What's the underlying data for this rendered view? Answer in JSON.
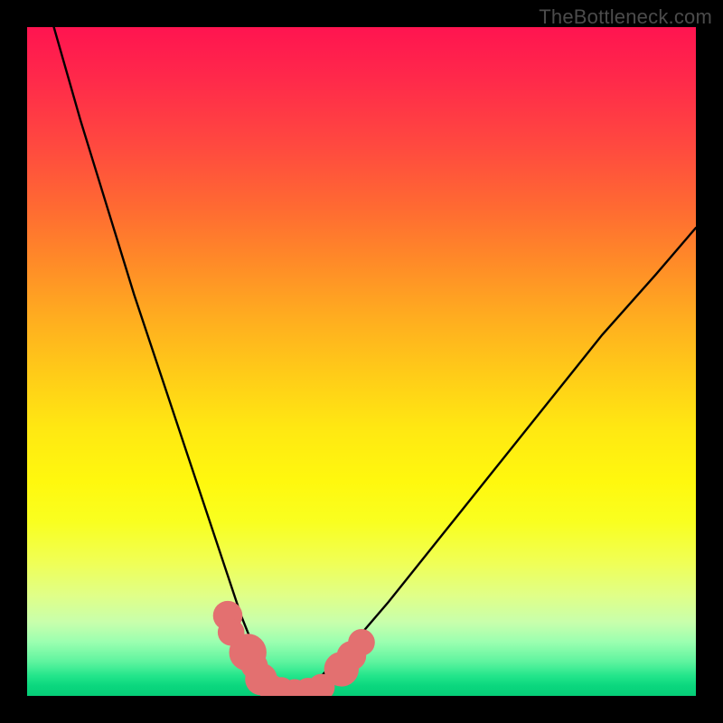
{
  "watermark": "TheBottleneck.com",
  "gradient_colors": {
    "top": "#ff1450",
    "mid_orange": "#ff8a28",
    "mid_yellow": "#fff80e",
    "bottom": "#05cd77"
  },
  "chart_data": {
    "type": "line",
    "title": "",
    "xlabel": "",
    "ylabel": "",
    "x_range": [
      0,
      100
    ],
    "y_range": [
      0,
      100
    ],
    "series": [
      {
        "name": "bottleneck-curve",
        "x": [
          4,
          8,
          12,
          16,
          20,
          24,
          28,
          30,
          32,
          34,
          36,
          38,
          40,
          42,
          44,
          48,
          54,
          62,
          70,
          78,
          86,
          94,
          100
        ],
        "values": [
          100,
          86,
          73,
          60,
          48,
          36,
          24,
          18,
          12,
          7,
          3,
          1,
          0.3,
          1,
          3,
          7,
          14,
          24,
          34,
          44,
          54,
          63,
          70
        ]
      }
    ],
    "markers": [
      {
        "name": "points-left",
        "x": 30,
        "y": 12,
        "r": 2.2
      },
      {
        "name": "points-left",
        "x": 30.5,
        "y": 9.5,
        "r": 2.0
      },
      {
        "name": "points-left",
        "x": 33,
        "y": 6.5,
        "r": 2.8
      },
      {
        "name": "points-left",
        "x": 34,
        "y": 4.5,
        "r": 2.0
      },
      {
        "name": "points-left",
        "x": 35,
        "y": 2.5,
        "r": 2.4
      },
      {
        "name": "points-left",
        "x": 36.5,
        "y": 1.2,
        "r": 2.0
      },
      {
        "name": "points-bottom",
        "x": 38,
        "y": 0.8,
        "r": 2.0
      },
      {
        "name": "points-bottom",
        "x": 40,
        "y": 0.5,
        "r": 2.0
      },
      {
        "name": "points-bottom",
        "x": 42,
        "y": 0.7,
        "r": 2.0
      },
      {
        "name": "points-bottom",
        "x": 44,
        "y": 1.3,
        "r": 2.0
      },
      {
        "name": "points-right",
        "x": 47,
        "y": 4.0,
        "r": 2.6
      },
      {
        "name": "points-right",
        "x": 48.5,
        "y": 6.0,
        "r": 2.2
      },
      {
        "name": "points-right",
        "x": 50,
        "y": 8.0,
        "r": 2.0
      }
    ],
    "marker_color": "#e37070"
  }
}
